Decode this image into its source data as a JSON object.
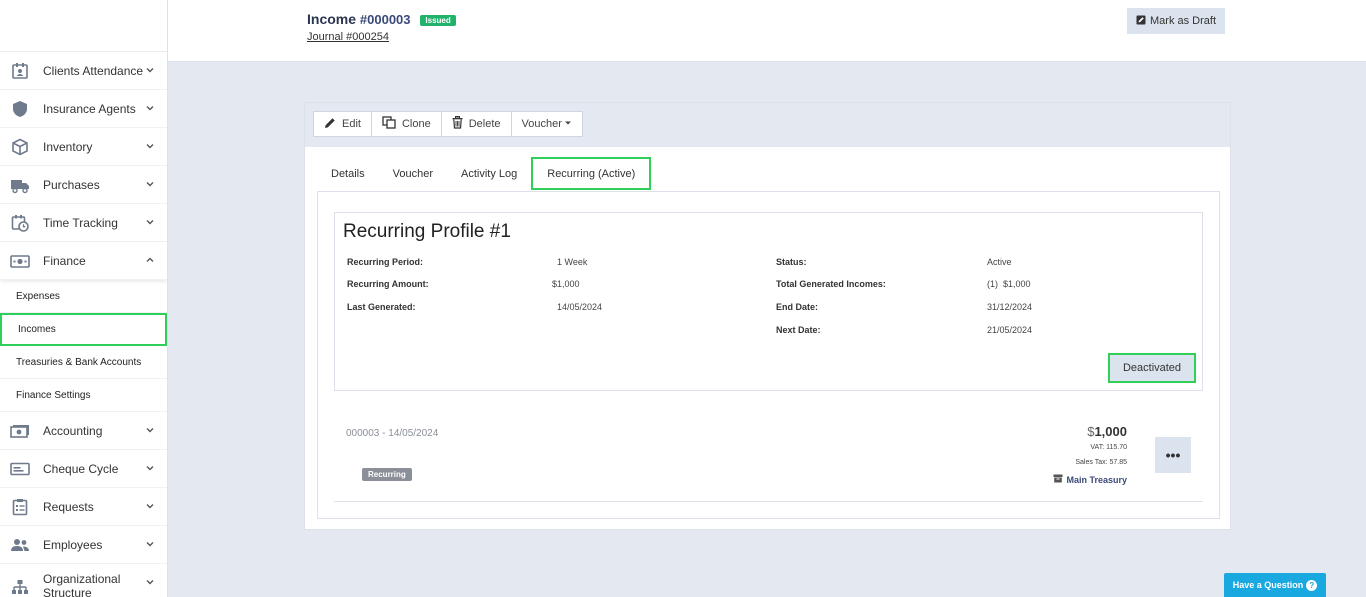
{
  "sidebar": {
    "items_top": [
      {
        "label": "Clients Attendance",
        "icon": "calendar-user-icon"
      },
      {
        "label": "Insurance Agents",
        "icon": "shield-icon"
      },
      {
        "label": "Inventory",
        "icon": "box-icon"
      },
      {
        "label": "Purchases",
        "icon": "truck-icon"
      },
      {
        "label": "Time Tracking",
        "icon": "calendar-clock-icon"
      },
      {
        "label": "Finance",
        "icon": "money-icon"
      }
    ],
    "finance_sub": [
      "Expenses",
      "Incomes",
      "Treasuries & Bank Accounts",
      "Finance Settings"
    ],
    "items_bottom": [
      {
        "label": "Accounting",
        "icon": "cash-icon"
      },
      {
        "label": "Cheque Cycle",
        "icon": "cheque-icon"
      },
      {
        "label": "Requests",
        "icon": "clipboard-icon"
      },
      {
        "label": "Employees",
        "icon": "users-icon"
      },
      {
        "label": "Organizational Structure",
        "icon": "org-chart-icon"
      }
    ]
  },
  "header": {
    "title": "Income",
    "number": "#000003",
    "status_badge": "Issued",
    "journal_link": "Journal #000254",
    "mark_draft_label": "Mark as Draft"
  },
  "toolbar": {
    "edit": "Edit",
    "clone": "Clone",
    "delete": "Delete",
    "voucher": "Voucher"
  },
  "tabs": [
    "Details",
    "Voucher",
    "Activity Log",
    "Recurring (Active)"
  ],
  "profile": {
    "title": "Recurring Profile #1",
    "recurring_period_label": "Recurring Period:",
    "recurring_period": "1 Week",
    "recurring_amount_label": "Recurring Amount:",
    "recurring_amount": "$1,000",
    "last_generated_label": "Last Generated:",
    "last_generated": "14/05/2024",
    "status_label": "Status:",
    "status": "Active",
    "total_generated_label": "Total Generated Incomes:",
    "total_generated": "(1)  $1,000",
    "end_date_label": "End Date:",
    "end_date": "31/12/2024",
    "next_date_label": "Next Date:",
    "next_date": "21/05/2024",
    "deactivate_label": "Deactivated"
  },
  "income_row": {
    "ref": "000003 - 14/05/2024",
    "badge": "Recurring",
    "currency": "$",
    "amount": "1,000",
    "vat": "VAT: 115.70",
    "sales_tax": "Sales Tax: 57.85",
    "treasury": "Main Treasury",
    "more": "•••"
  },
  "help": {
    "label": "Have a Question",
    "mark": "?"
  }
}
